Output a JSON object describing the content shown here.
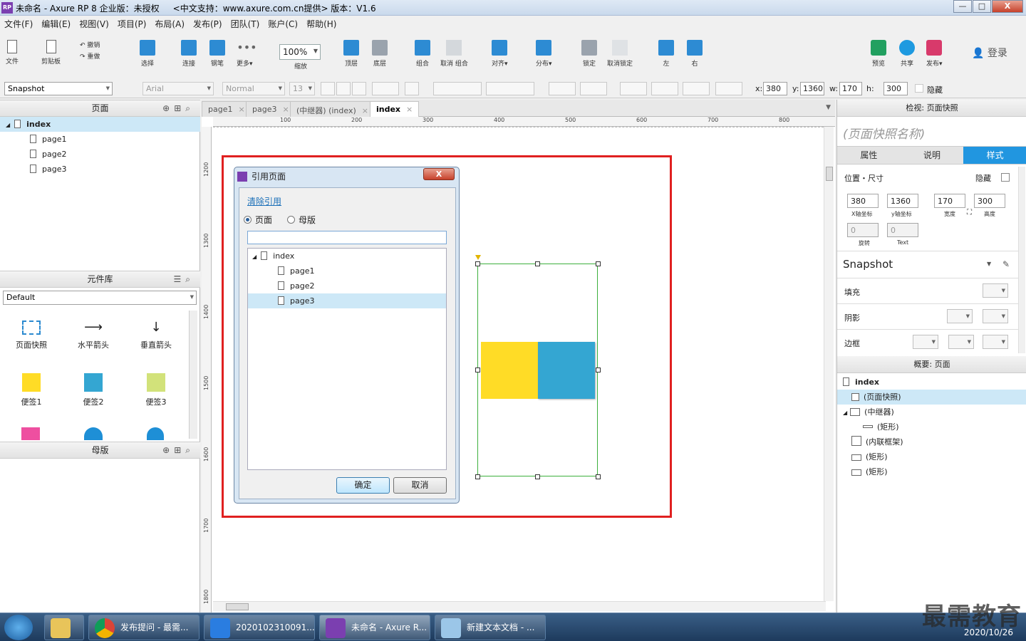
{
  "window": {
    "title": "未命名 - Axure RP 8 企业版：未授权     <中文支持：www.axure.com.cn提供> 版本：V1.6",
    "min": "—",
    "max": "□",
    "close": "X"
  },
  "menu": [
    "文件(F)",
    "编辑(E)",
    "视图(V)",
    "项目(P)",
    "布局(A)",
    "发布(P)",
    "团队(T)",
    "账户(C)",
    "帮助(H)"
  ],
  "toolbar": {
    "file": "文件",
    "clipboard": "剪贴板",
    "undo": "撤销",
    "redo": "重做",
    "select": "选择",
    "connect": "连接",
    "pen": "钢笔",
    "more": "更多▾",
    "zoom": "100%",
    "zoom_label": "缩放",
    "top": "顶层",
    "bottom": "底层",
    "group": "组合",
    "ungroup": "取消 组合",
    "align": "对齐▾",
    "distribute": "分布▾",
    "lock": "锁定",
    "unlock": "取消锁定",
    "left": "左",
    "right": "右",
    "preview": "预览",
    "share": "共享",
    "publish": "发布▾",
    "login": "登录"
  },
  "formatbar": {
    "style": "Snapshot",
    "font": "Arial",
    "weight": "Normal",
    "size": "13",
    "x_label": "x:",
    "x": "380",
    "y_label": "y:",
    "y": "1360",
    "w_label": "w:",
    "w": "170",
    "h_label": "h:",
    "h": "300",
    "hidden": "隐藏"
  },
  "pages": {
    "title": "页面",
    "items": [
      {
        "name": "index"
      },
      {
        "name": "page1"
      },
      {
        "name": "page2"
      },
      {
        "name": "page3"
      }
    ]
  },
  "library": {
    "title": "元件库",
    "selected": "Default",
    "widgets": [
      "页面快照",
      "水平箭头",
      "垂直箭头",
      "便签1",
      "便签2",
      "便签3"
    ]
  },
  "masters": {
    "title": "母版"
  },
  "tabs": [
    "page1",
    "page3",
    "(中继器) (index)",
    "index"
  ],
  "rulers": {
    "h": [
      "100",
      "200",
      "300",
      "400",
      "500",
      "600",
      "700",
      "800"
    ],
    "v": [
      "1200",
      "1300",
      "1400",
      "1500",
      "1600",
      "1700",
      "1800"
    ]
  },
  "dialog": {
    "title": "引用页面",
    "clear_link": "清除引用",
    "radio_page": "页面",
    "radio_master": "母版",
    "tree": [
      "index",
      "page1",
      "page2",
      "page3"
    ],
    "ok": "确定",
    "cancel": "取消"
  },
  "inspector": {
    "header": "检视: 页面快照",
    "name_placeholder": "(页面快照名称)",
    "tabs": [
      "属性",
      "说明",
      "样式"
    ],
    "section_pos": "位置・尺寸",
    "hidden": "隐藏",
    "x": "380",
    "y": "1360",
    "w": "170",
    "h": "300",
    "x_cap": "X轴坐标",
    "y_cap": "y轴坐标",
    "w_cap": "宽度",
    "h_cap": "高度",
    "rot": "0",
    "text_rot": "0",
    "rot_cap": "旋转",
    "text_cap": "Text",
    "style": "Snapshot",
    "fill": "填充",
    "shadow": "阴影",
    "border": "边框"
  },
  "outline": {
    "header": "概要: 页面",
    "items": [
      "index",
      "(页面快照)",
      "(中继器)",
      "(矩形)",
      "(内联框架)",
      "(矩形)",
      "(矩形)"
    ]
  },
  "taskbar": {
    "items": [
      "发布提问 - 最需...",
      "2020102310091...",
      "未命名 - Axure R...",
      "新建文本文档 - ..."
    ],
    "time": "2020/10/26",
    "watermark": "最需教育"
  },
  "colors": {
    "snapshot_yellow": "#ffdc26",
    "snapshot_blue": "#34a6d2",
    "highlight_red": "#e02020",
    "accent_blue": "#2196e0"
  }
}
